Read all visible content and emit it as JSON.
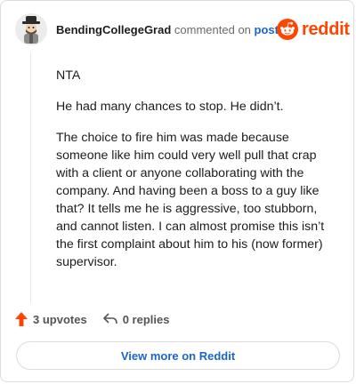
{
  "header": {
    "username": "BendingCollegeGrad",
    "action_text": "commented on",
    "post_link": "post"
  },
  "brand": {
    "wordmark": "reddit",
    "color": "#ff4500",
    "icon": "reddit-snoo-icon"
  },
  "comment": {
    "paragraphs": [
      "NTA",
      "He had many chances to stop. He didn’t.",
      "The choice to fire him was made because someone like him could very well pull that crap with a client or anyone collaborating with the company. And having been a boss to a guy like that? It tells me he is aggressive, too stubborn, and cannot listen. I can almost promise this isn’t the first complaint about him to his (now former) supervisor."
    ]
  },
  "actions": {
    "upvotes": "3 upvotes",
    "replies": "0 replies",
    "upvote_icon": "upvote-arrow-icon",
    "reply_icon": "reply-arrow-icon",
    "upvote_color": "#ff4500"
  },
  "footer": {
    "view_more": "View more on Reddit",
    "link_color": "#1a66c9"
  }
}
